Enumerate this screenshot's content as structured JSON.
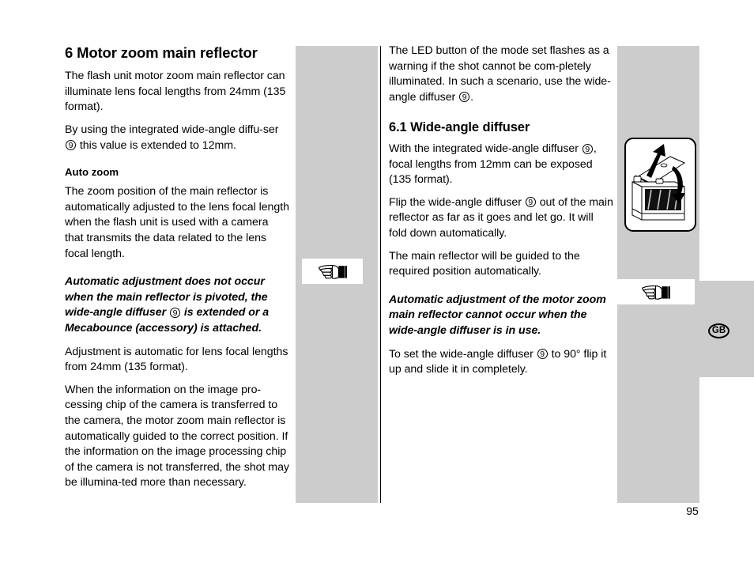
{
  "page": {
    "number": "95",
    "language_marker": "GB"
  },
  "left_column": {
    "chapter_title": "6 Motor zoom main reflector",
    "paragraph_1": "The flash unit motor zoom main reflector can illuminate lens focal lengths from 24mm (135 format).",
    "paragraph_2_before": "By using the integrated wide-angle diffu-ser",
    "paragraph_2_ref": "9",
    "paragraph_2_after": "this value is extended to 12mm.",
    "sub_title": "Auto zoom",
    "paragraph_3": "The zoom position of the main reflector is automatically adjusted to the lens focal length when the flash unit is used with a camera that transmits the data related to the lens focal length.",
    "note_before": "Automatic adjustment does not occur when the main reflector is pivoted, the wide-angle diffuser",
    "note_ref": "9",
    "note_after": "is extended or a Mecabounce (accessory) is attached.",
    "paragraph_4": "Adjustment is automatic for lens focal lengths from 24mm  (135 format).",
    "paragraph_5": "When the information on the image pro-cessing chip of the camera is transferred to the camera, the motor zoom main reflector is automatically guided to the correct position. If the information on the image processing chip of the camera is not transferred, the shot may be illumina-ted more than necessary."
  },
  "right_column": {
    "paragraph_1_before": "The LED button of the mode set flashes as a warning if the shot cannot be com-pletely illuminated. In such a scenario, use the wide-angle diffuser",
    "paragraph_1_ref": "9",
    "paragraph_1_after": ".",
    "section_title": "6.1 Wide-angle diffuser",
    "paragraph_2_before": "With the integrated wide-angle diffuser",
    "paragraph_2_ref": "9",
    "paragraph_2_after": ", focal lengths from 12mm can be exposed (135 format).",
    "paragraph_3_before": "Flip the wide-angle diffuser",
    "paragraph_3_ref": "9",
    "paragraph_3_after": "out of the main reflector as far as it goes and let go. It will fold down automatically.",
    "paragraph_4": "The main reflector will be guided to the required position automatically.",
    "note": "Automatic adjustment of the motor zoom main reflector cannot occur when the wide-angle diffuser is in use.",
    "paragraph_5_before": "To set the wide-angle diffuser",
    "paragraph_5_ref": "9",
    "paragraph_5_after": "to 90° flip it up and slide it in completely."
  },
  "icons": {
    "hand_left": "pointing-hand-icon",
    "hand_right": "pointing-hand-icon",
    "illustration": "flash-head-diffuser-illustration"
  },
  "colors": {
    "band_gray": "#cccccc",
    "text_black": "#000000",
    "page_white": "#ffffff"
  }
}
